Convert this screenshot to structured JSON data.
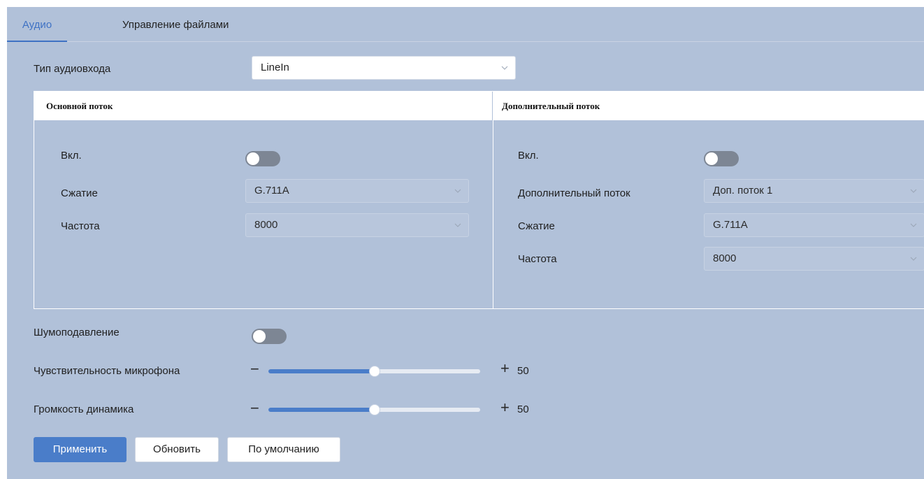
{
  "tabs": [
    {
      "label": "Аудио",
      "active": true
    },
    {
      "label": "Управление файлами",
      "active": false
    }
  ],
  "audio_input": {
    "label": "Тип аудиовхода",
    "value": "LineIn"
  },
  "main_stream": {
    "title": "Основной поток",
    "enable_label": "Вкл.",
    "enabled": false,
    "compression_label": "Сжатие",
    "compression_value": "G.711A",
    "frequency_label": "Частота",
    "frequency_value": "8000"
  },
  "sub_stream": {
    "title": "Дополнительный поток",
    "enable_label": "Вкл.",
    "enabled": false,
    "stream_label": "Дополнительный поток",
    "stream_value": "Доп. поток 1",
    "compression_label": "Сжатие",
    "compression_value": "G.711A",
    "frequency_label": "Частота",
    "frequency_value": "8000"
  },
  "noise_reduction": {
    "label": "Шумоподавление",
    "enabled": false
  },
  "mic_sensitivity": {
    "label": "Чувствительность микрофона",
    "minus": "−",
    "plus": "+",
    "value": "50",
    "fraction": 0.5
  },
  "speaker_volume": {
    "label": "Громкость динамика",
    "minus": "−",
    "plus": "+",
    "value": "50",
    "fraction": 0.5
  },
  "buttons": {
    "apply": "Применить",
    "refresh": "Обновить",
    "default": "По умолчанию"
  },
  "colors": {
    "background": "#b1c1d9",
    "accent": "#4a7dc9",
    "toggle_off": "#7d8694"
  },
  "icons": {
    "dropdown": "chevron-down-icon"
  }
}
